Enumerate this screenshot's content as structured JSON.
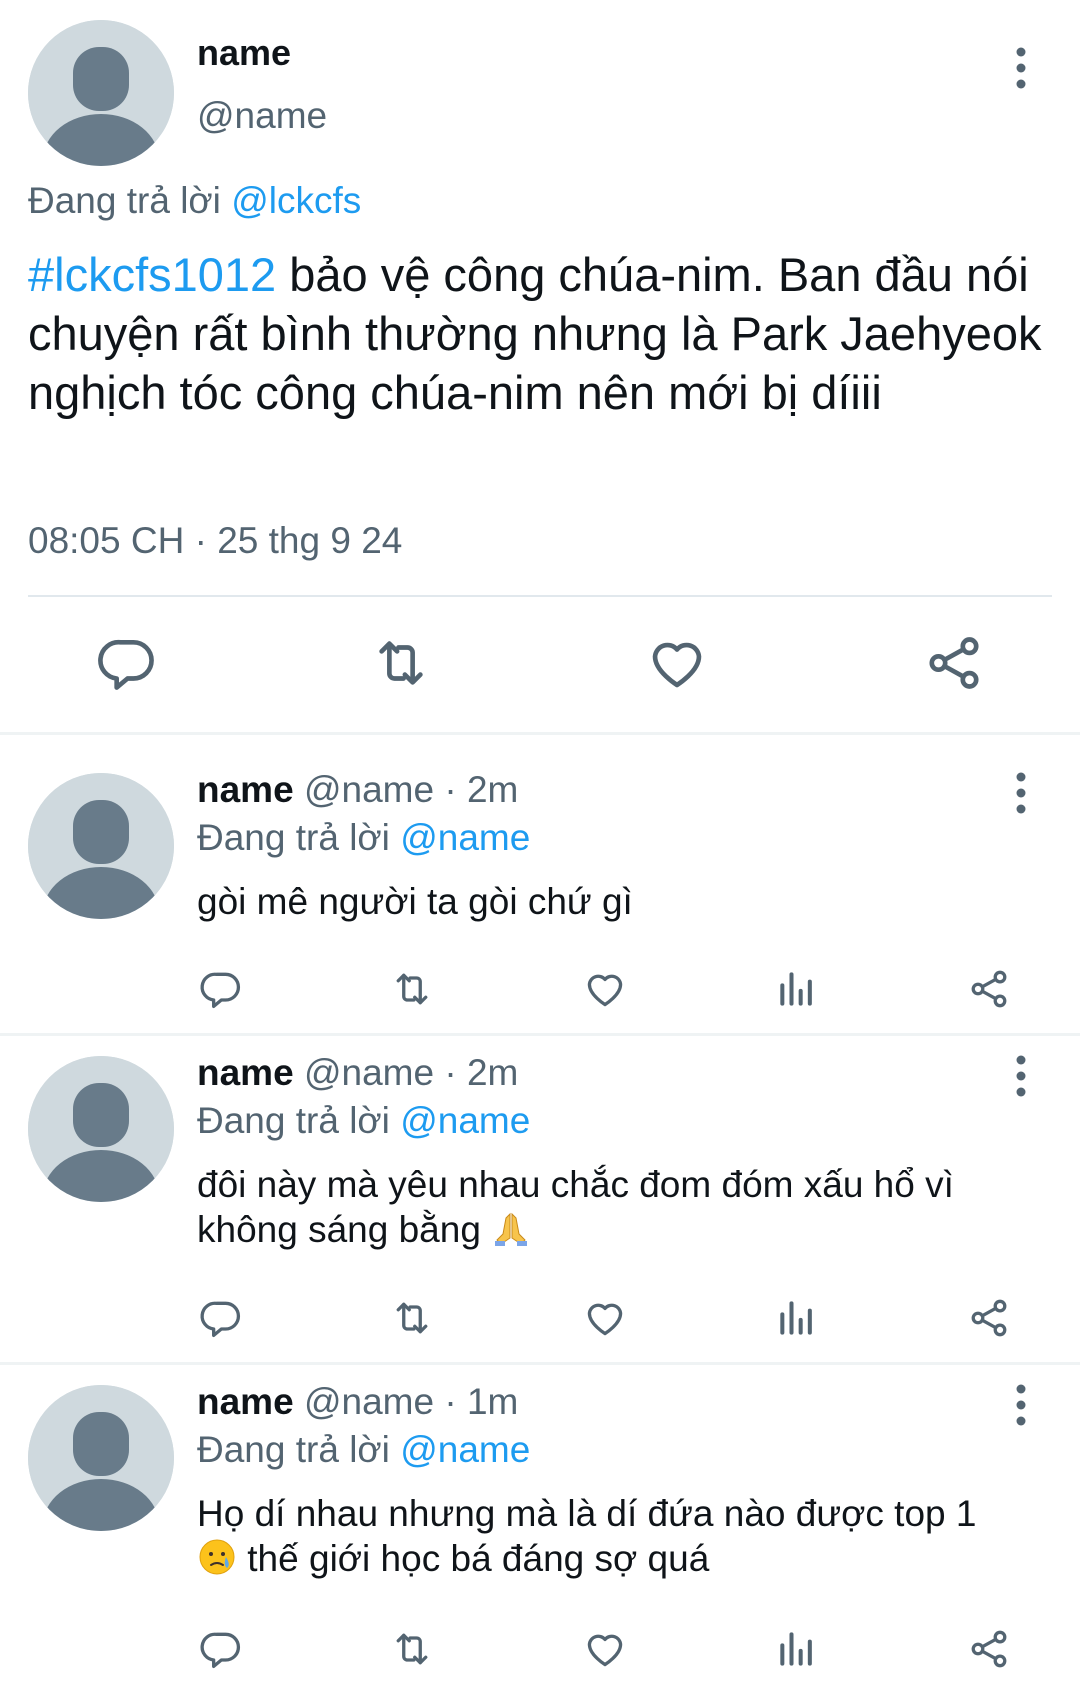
{
  "main_tweet": {
    "name": "name",
    "handle": "@name",
    "replying_prefix": "Đang trả lời",
    "replying_to": "@lckcfs",
    "hashtag": "#lckcfs1012",
    "text": " bảo vệ công chúa-nim. Ban đầu nói chuyện rất bình thường nhưng là Park Jaehyeok nghịch tóc công chúa-nim nên mới bị díiii",
    "timestamp": "08:05 CH · 25 thg 9 24",
    "icons": [
      "reply-icon",
      "retweet-icon",
      "like-icon",
      "share-icon"
    ]
  },
  "replies": [
    {
      "name": "name",
      "handle": "@name",
      "time": "· 2m",
      "replying_prefix": "Đang trả lời",
      "replying_to": "@name",
      "text": "gòi mê người ta gòi chứ gì"
    },
    {
      "name": "name",
      "handle": "@name",
      "time": "· 2m",
      "replying_prefix": "Đang trả lời",
      "replying_to": "@name",
      "text": "đôi này mà yêu nhau chắc đom đóm xấu hổ vì không sáng bằng",
      "emoji": "folded-hands-emoji"
    },
    {
      "name": "name",
      "handle": "@name",
      "time": "· 1m",
      "replying_prefix": "Đang trả lời",
      "replying_to": "@name",
      "text_emoji": "crying-face-emoji",
      "text_line1": "Họ dí nhau nhưng mà là dí đứa nào được top 1",
      "text_line2": "thế giới học bá đáng sợ quá"
    }
  ],
  "colors": {
    "link": "#1d9bf0",
    "muted": "#536471",
    "text": "#0f1419",
    "avatar_bg": "#cfd9de",
    "avatar_fg": "#687b8a"
  }
}
